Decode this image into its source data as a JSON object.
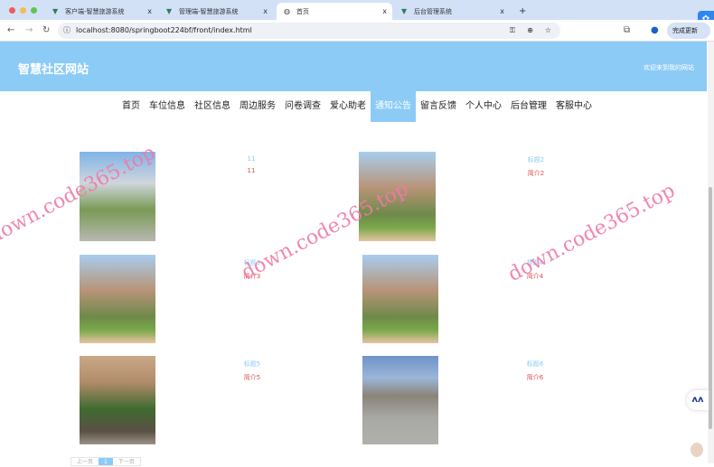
{
  "browser": {
    "tabs": [
      {
        "label": "客户端-智慧旅游系统",
        "icon": "vue-icon"
      },
      {
        "label": "管理端-智慧旅游系统",
        "icon": "vue-icon"
      },
      {
        "label": "首页",
        "icon": "globe-icon",
        "active": true
      },
      {
        "label": "后台管理系统",
        "icon": "vue-icon"
      }
    ],
    "close": "x",
    "new_tab": "+",
    "url": "localhost:8080/springboot224bf/front/index.html",
    "update_label": "完成更新"
  },
  "header": {
    "title": "智慧社区网站",
    "welcome": "欢迎来到我的网站"
  },
  "menu": [
    {
      "label": "首页"
    },
    {
      "label": "车位信息"
    },
    {
      "label": "社区信息"
    },
    {
      "label": "周边服务"
    },
    {
      "label": "问卷调查"
    },
    {
      "label": "爱心助老"
    },
    {
      "label": "通知公告",
      "active": true
    },
    {
      "label": "留言反馈"
    },
    {
      "label": "个人中心"
    },
    {
      "label": "后台管理"
    },
    {
      "label": "客服中心"
    }
  ],
  "items": [
    {
      "title": "11",
      "desc": "11"
    },
    {
      "title": "标题2",
      "desc": "简介2"
    },
    {
      "title": "标题3",
      "desc": "简介3"
    },
    {
      "title": "标题4",
      "desc": "简介4"
    },
    {
      "title": "标题5",
      "desc": "简介5"
    },
    {
      "title": "标题6",
      "desc": "简介6"
    }
  ],
  "pager": {
    "prev": "上一页",
    "current": "1",
    "next": "下一页"
  },
  "watermark": "down.code365.top",
  "colors": {
    "accent": "#8ccbf5",
    "desc": "#d9534f"
  }
}
